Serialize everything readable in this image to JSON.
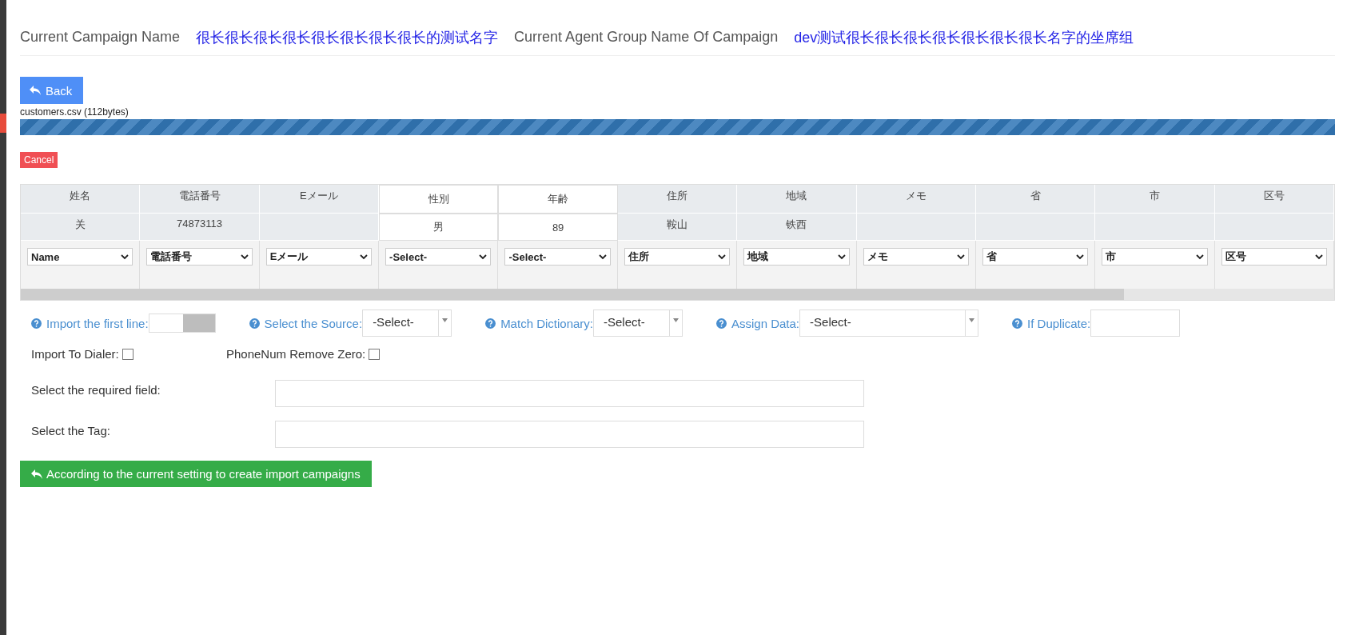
{
  "header": {
    "campaign_label": "Current Campaign Name",
    "campaign_name": "很长很长很长很长很长很长很长很长的测试名字",
    "group_label": "Current Agent Group Name Of Campaign",
    "group_name": "dev测试很长很长很长很长很长很长很长名字的坐席组"
  },
  "back_button": "Back",
  "upload": {
    "filename": "customers.csv (112bytes)",
    "cancel": "Cancel"
  },
  "table": {
    "columns": [
      {
        "header": "姓名",
        "value": "关",
        "mapping": "Name",
        "highlighted": false
      },
      {
        "header": "電話番号",
        "value": "74873113",
        "mapping": "電話番号",
        "highlighted": false
      },
      {
        "header": "Eメール",
        "mapping": "Eメール",
        "highlighted": false
      },
      {
        "header": "性別",
        "value": "男",
        "mapping": "-Select-",
        "highlighted": true
      },
      {
        "header": "年齢",
        "value": "89",
        "mapping": "-Select-",
        "highlighted": true
      },
      {
        "header": "住所",
        "value": "鞍山",
        "mapping": "住所",
        "highlighted": false
      },
      {
        "header": "地域",
        "value": "铁西",
        "mapping": "地域",
        "highlighted": false
      },
      {
        "header": "メモ",
        "mapping": "メモ",
        "highlighted": false
      },
      {
        "header": "省",
        "mapping": "省",
        "highlighted": false
      },
      {
        "header": "市",
        "mapping": "市",
        "highlighted": false
      },
      {
        "header": "区号",
        "mapping": "区号",
        "highlighted": false
      }
    ]
  },
  "options": [
    {
      "kind": "switch",
      "label": "Import the first line:",
      "on": false
    },
    {
      "kind": "select",
      "label": "Select the Source:",
      "value": "-Select-"
    },
    {
      "kind": "select",
      "label": "Match Dictionary:",
      "value": "-Select-"
    },
    {
      "kind": "wideselect",
      "label": "Assign Data:",
      "value": "-Select-"
    },
    {
      "kind": "input",
      "label": "If Duplicate:"
    }
  ],
  "checkboxes": [
    {
      "label": "Import To Dialer:",
      "checked": false
    },
    {
      "label": "PhoneNum Remove Zero:",
      "checked": false
    }
  ],
  "fields": [
    {
      "label": "Select the required field:"
    },
    {
      "label": "Select the Tag:"
    }
  ],
  "submit_button": "According to the current setting to create import campaigns"
}
